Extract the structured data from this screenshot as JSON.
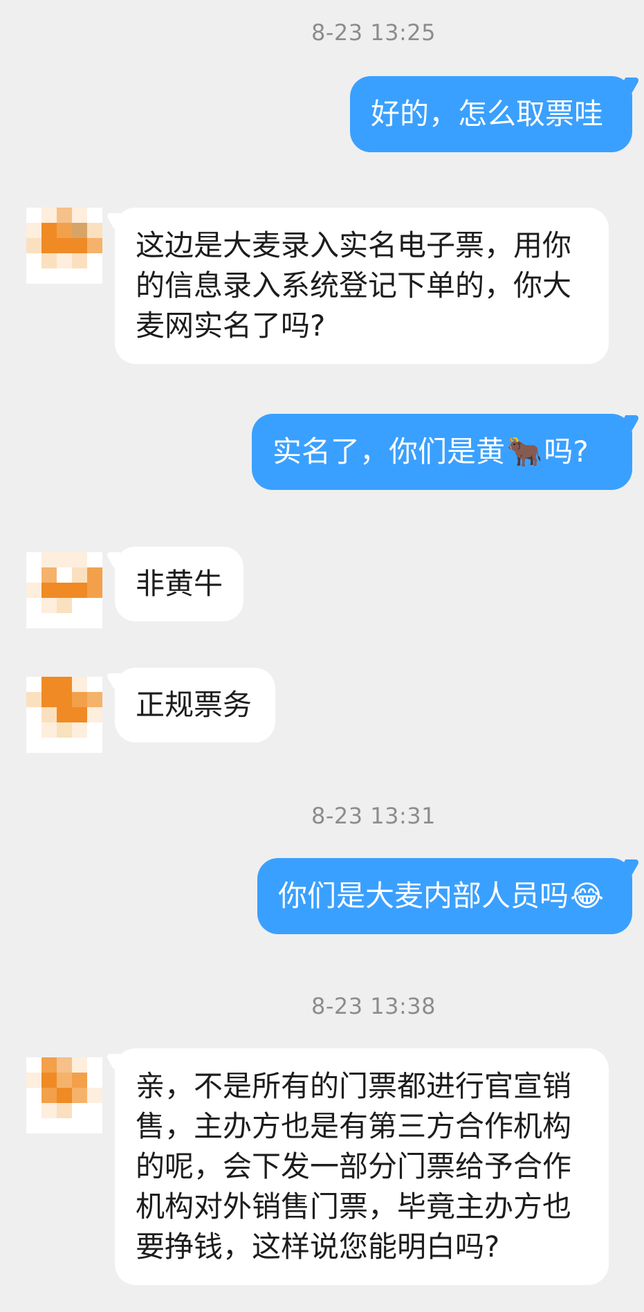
{
  "timestamps": [
    "8-23 13:25",
    "8-23 13:31",
    "8-23 13:38"
  ],
  "messages": [
    {
      "from": "me",
      "text": "好的，怎么取票哇"
    },
    {
      "from": "other",
      "text": "这边是大麦录入实名电子票，用你的信息录入系统登记下单的，你大麦网实名了吗?"
    },
    {
      "from": "me",
      "text_before": "实名了，你们是黄",
      "emoji": "🐂",
      "text_after": "吗?"
    },
    {
      "from": "other",
      "text": "非黄牛"
    },
    {
      "from": "other",
      "text": "正规票务"
    },
    {
      "from": "me",
      "text_before": "你们是大麦内部人员吗",
      "emoji": "😂",
      "text_after": ""
    },
    {
      "from": "other",
      "text": "亲，不是所有的门票都进行官宣销售，主办方也是有第三方合作机构的呢，会下发一部分门票给予合作机构对外销售门票，毕竟主办方也要挣钱，这样说您能明白吗?"
    }
  ],
  "colors": {
    "background": "#efefef",
    "my_bubble": "#3aa0ff",
    "their_bubble": "#ffffff",
    "timestamp_text": "#8c8c8c",
    "avatar_orange": "#f08a24"
  },
  "avatar": {
    "semantic": "pixelated-user-avatar"
  }
}
